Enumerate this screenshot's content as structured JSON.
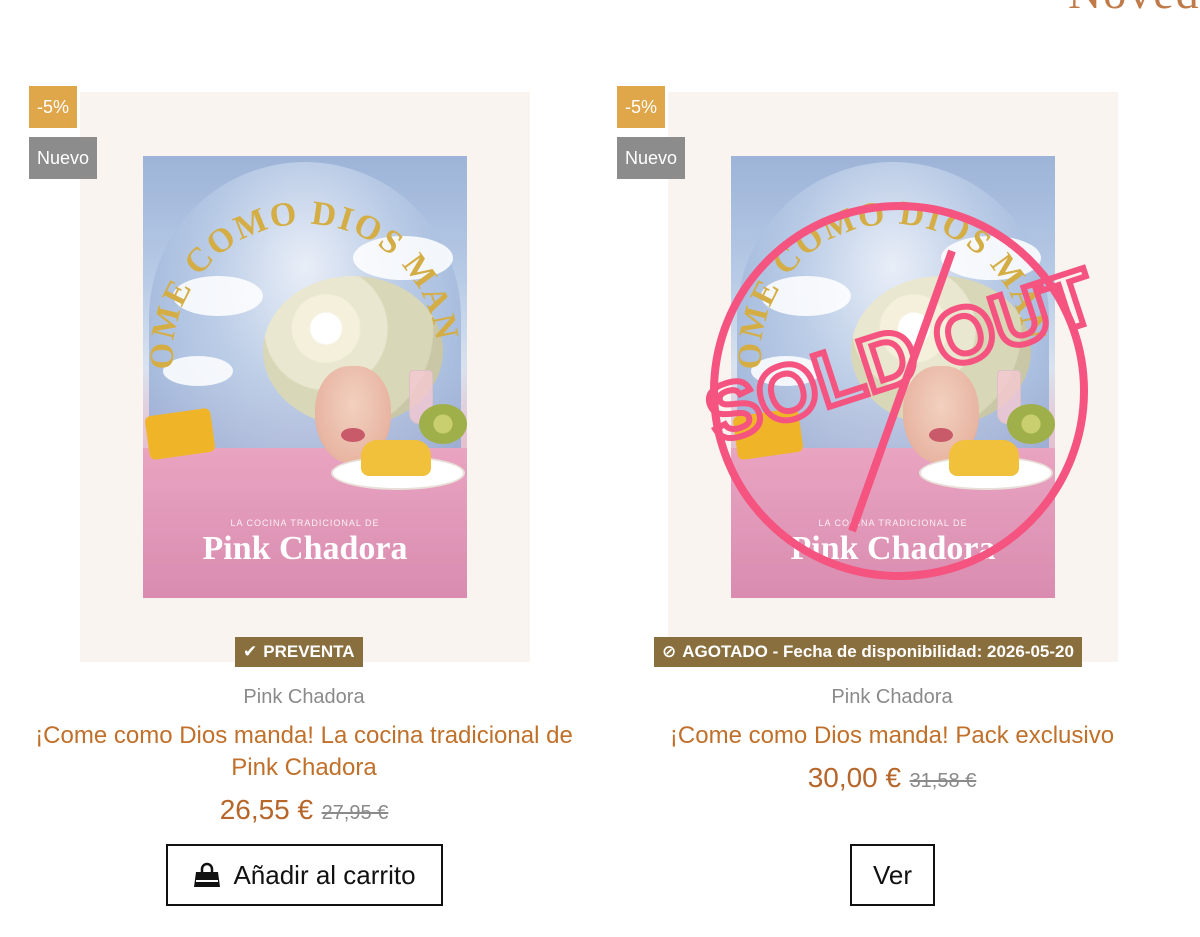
{
  "section": {
    "title": "Noved"
  },
  "products": [
    {
      "discount_badge": "-5%",
      "new_badge": "Nuevo",
      "cover_subtitle": "LA COCINA TRADICIONAL DE",
      "cover_brand": "Pink Chadora",
      "cover_arc_text": "¡COME COMO DIOS MANDA!",
      "status": "PREVENTA",
      "status_icon": "check-icon",
      "author": "Pink Chadora",
      "title": "¡Come como Dios manda! La cocina tradicional de Pink Chadora",
      "price": "26,55 €",
      "old_price": "27,95 €",
      "button_label": "Añadir al carrito",
      "button_icon": "shopping-bag-icon"
    },
    {
      "discount_badge": "-5%",
      "new_badge": "Nuevo",
      "cover_subtitle": "LA COCINA TRADICIONAL DE",
      "cover_brand": "Pink Chadora",
      "cover_arc_text": "¡COME COMO DIOS MANDA!",
      "sold_out_stamp": "SOLD OUT",
      "status": "AGOTADO - Fecha de disponibilidad: 2026-05-20",
      "status_icon": "ban-icon",
      "author": "Pink Chadora",
      "title": "¡Come como Dios manda! Pack exclusivo",
      "price": "30,00 €",
      "old_price": "31,58 €",
      "button_label": "Ver"
    }
  ],
  "colors": {
    "discount_badge": "#e0a64a",
    "new_badge": "#8c8c8c",
    "status_label": "#8a6f3e",
    "title": "#c0702a",
    "price": "#b6662a",
    "sold_out": "#f4547f"
  }
}
